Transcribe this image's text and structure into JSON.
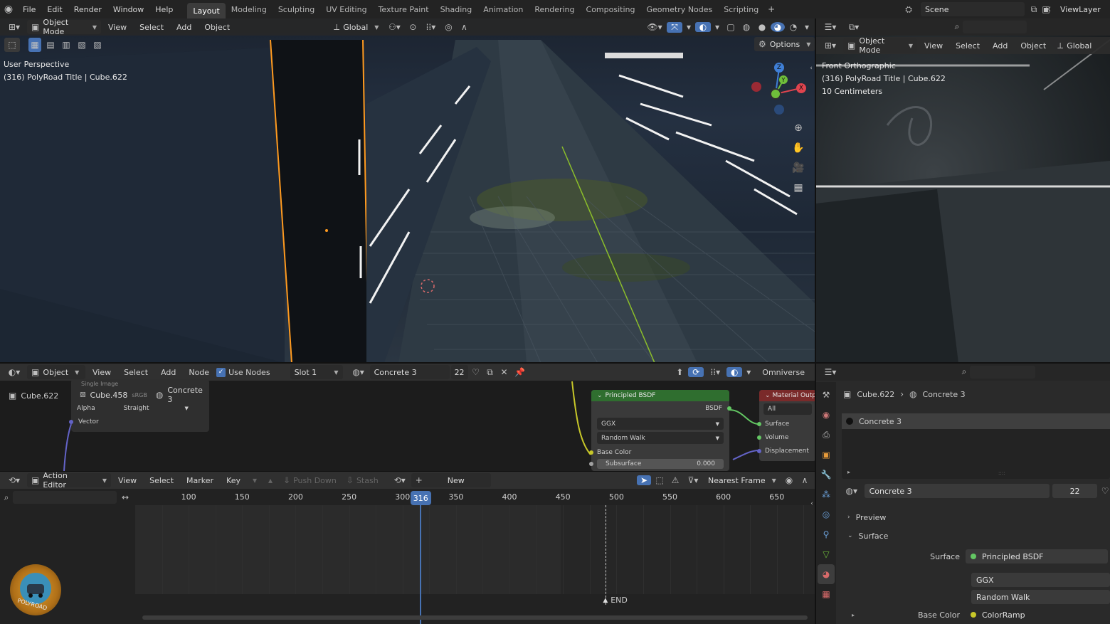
{
  "topbar": {
    "menus": [
      "File",
      "Edit",
      "Render",
      "Window",
      "Help"
    ],
    "workspaces": [
      "Layout",
      "Modeling",
      "Sculpting",
      "UV Editing",
      "Texture Paint",
      "Shading",
      "Animation",
      "Rendering",
      "Compositing",
      "Geometry Nodes",
      "Scripting"
    ],
    "active_workspace": "Layout",
    "scene": "Scene",
    "view_layer": "ViewLayer"
  },
  "viewport": {
    "mode": "Object Mode",
    "menus": [
      "View",
      "Select",
      "Add",
      "Object"
    ],
    "transform_orientation": "Global",
    "options_label": "Options",
    "overlay_title": "User Perspective",
    "overlay_object": "(316) PolyRoad Title | Cube.622",
    "gizmo_axes": [
      "Z",
      "Y",
      "X"
    ]
  },
  "side_viewport": {
    "mode": "Object Mode",
    "menus": [
      "View",
      "Select",
      "Add",
      "Object"
    ],
    "transform_orientation": "Global",
    "overlay_title": "Front Orthographic",
    "overlay_object": "(316) PolyRoad Title | Cube.622",
    "overlay_scale": "10 Centimeters"
  },
  "node_editor": {
    "type_label": "Object",
    "menus": [
      "View",
      "Select",
      "Add",
      "Node"
    ],
    "use_nodes_label": "Use Nodes",
    "use_nodes_checked": true,
    "slot": "Slot 1",
    "material": "Concrete 3",
    "users": "22",
    "render_engine": "Omniverse",
    "breadcrumb_object": "Cube.622",
    "breadcrumb_material": "Concrete 3",
    "image_node": {
      "title": "Single Image",
      "color_space_label": "sRGB",
      "alpha_label": "Alpha",
      "alpha_value": "Straight",
      "vector_label": "Vector",
      "file_label": "Cube.458"
    },
    "bsdf_node": {
      "title": "Principled BSDF",
      "output_label": "BSDF",
      "distribution": "GGX",
      "subsurface_method": "Random Walk",
      "base_color_label": "Base Color",
      "subsurface_label": "Subsurface",
      "subsurface_value": "0.000"
    },
    "output_node": {
      "title": "Material Outp",
      "target": "All",
      "inputs": [
        "Surface",
        "Volume",
        "Displacement"
      ]
    }
  },
  "action_editor": {
    "type_label": "Action Editor",
    "menus": [
      "View",
      "Select",
      "Marker",
      "Key"
    ],
    "push_down_label": "Push Down",
    "stash_label": "Stash",
    "new_label": "New",
    "interpolation": "Nearest Frame",
    "ruler_frames": [
      "100",
      "150",
      "200",
      "250",
      "300",
      "350",
      "400",
      "450",
      "500",
      "550",
      "600",
      "650"
    ],
    "current_frame": "316",
    "end_label": "END",
    "logo_text": "POLYROAD"
  },
  "properties": {
    "breadcrumb_object": "Cube.622",
    "breadcrumb_material": "Concrete 3",
    "material_slot": "Concrete 3",
    "material_name": "Concrete 3",
    "users": "22",
    "preview_label": "Preview",
    "surface_panel_label": "Surface",
    "surface_label": "Surface",
    "surface_value": "Principled BSDF",
    "distribution": "GGX",
    "subsurface_method": "Random Walk",
    "base_color_label": "Base Color",
    "base_color_value": "ColorRamp"
  },
  "colors": {
    "accent_blue": "#4772b3",
    "node_green": "#2f6e2f",
    "node_red": "#7a2a2a",
    "selection_orange": "#ff9a1f",
    "gizmo_x": "#e0444e",
    "gizmo_y": "#6fbf3a",
    "gizmo_z": "#3f7fd6"
  }
}
